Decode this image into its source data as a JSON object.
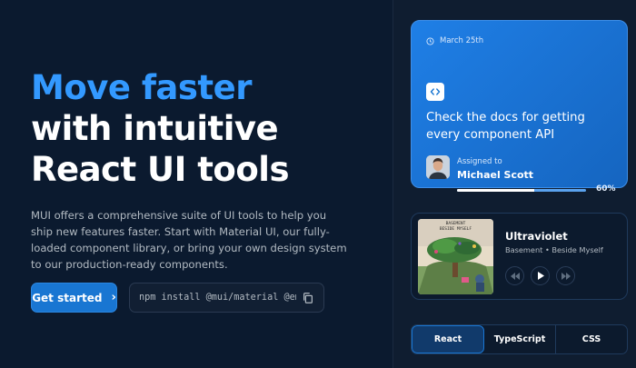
{
  "hero": {
    "title_line1": "Move faster",
    "title_line2": "with intuitive",
    "title_line3": "React UI tools",
    "description": "MUI offers a comprehensive suite of UI tools to help you ship new features faster. Start with Material UI, our fully-loaded component library, or bring your own design system to our production-ready components.",
    "cta_label": "Get started",
    "install_command": "npm install @mui/material @emotion/react @emotion/styled"
  },
  "task_card": {
    "date": "March 25th",
    "title": "Check the docs for getting every component API",
    "assigned_label": "Assigned to",
    "assignee": "Michael Scott",
    "progress_label": "60%",
    "progress": 0.6
  },
  "player": {
    "song": "Ultraviolet",
    "artist": "Basement • Beside Myself",
    "album_text": "BASEMENT\nBESIDE MYSELF"
  },
  "tabs": [
    {
      "label": "React",
      "active": true
    },
    {
      "label": "TypeScript",
      "active": false
    },
    {
      "label": "CSS",
      "active": false
    }
  ],
  "colors": {
    "accent": "#3399ff",
    "primary": "#1976d2",
    "background": "#0b1a2f"
  }
}
